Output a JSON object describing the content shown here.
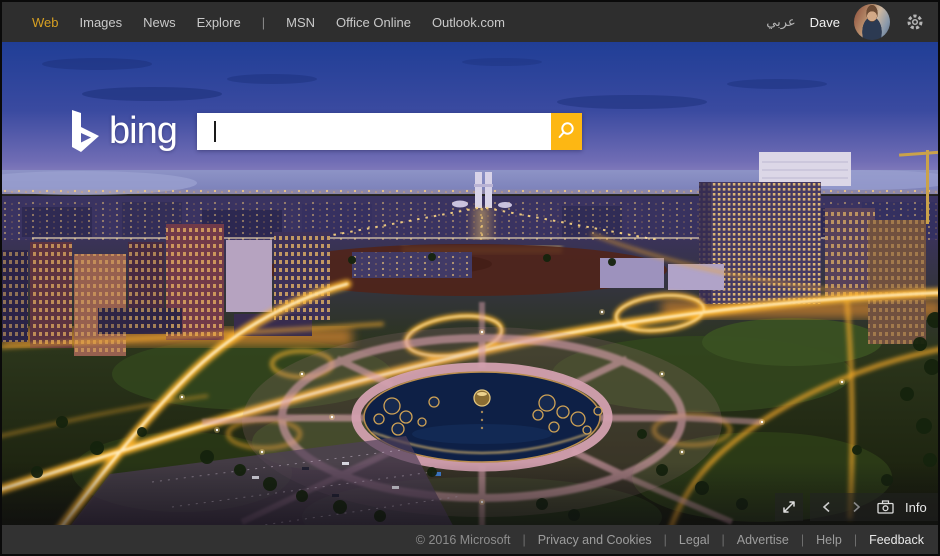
{
  "nav": {
    "tabs": [
      {
        "label": "Web",
        "active": true
      },
      {
        "label": "Images",
        "active": false
      },
      {
        "label": "News",
        "active": false
      },
      {
        "label": "Explore",
        "active": false
      }
    ],
    "divider": "|",
    "services": [
      {
        "label": "MSN"
      },
      {
        "label": "Office Online"
      },
      {
        "label": "Outlook.com"
      }
    ],
    "language": "عربي",
    "user": {
      "name": "Dave"
    }
  },
  "search": {
    "logo_text": "bing",
    "value": "",
    "placeholder": ""
  },
  "hero": {
    "controls": {
      "info_label": "Info"
    }
  },
  "footer": {
    "copyright": "© 2016 Microsoft",
    "divider": "|",
    "links": [
      {
        "label": "Privacy and Cookies"
      },
      {
        "label": "Legal"
      },
      {
        "label": "Advertise"
      },
      {
        "label": "Help"
      }
    ],
    "feedback": "Feedback"
  },
  "colors": {
    "accent_gold": "#fdb713",
    "active_tab_gold": "#d7a022",
    "nav_bg": "#2e2e2e",
    "footer_bg": "#323232",
    "sky_top": "#203e96",
    "fountain_water": "#0e2046"
  }
}
